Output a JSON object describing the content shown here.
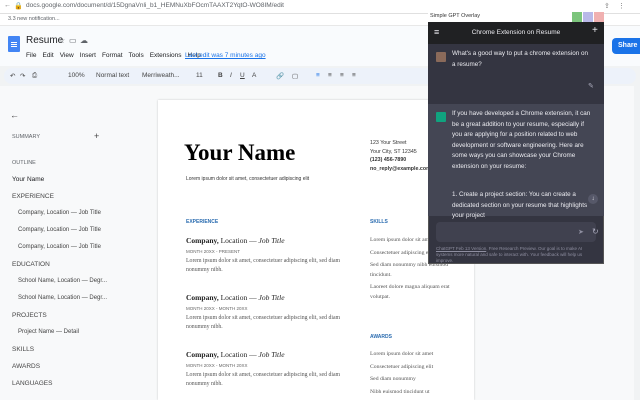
{
  "browser": {
    "url": "docs.google.com/document/d/15DgnaVnli_b1_HEMNuXbFOcmTAAXT2YqtO-WO8IM/edit",
    "bookmark": "3.3 new notification..."
  },
  "doc": {
    "title": "Resume",
    "menus": [
      "File",
      "Edit",
      "View",
      "Insert",
      "Format",
      "Tools",
      "Extensions",
      "Help"
    ],
    "last_edit": "Last edit was 7 minutes ago",
    "share_label": "Share"
  },
  "toolbar": {
    "zoom": "100%",
    "style": "Normal text",
    "font": "Merriweath...",
    "size": "11"
  },
  "outline": {
    "summary_label": "SUMMARY",
    "outline_label": "OUTLINE",
    "items": [
      {
        "label": "Your Name",
        "level": 1
      },
      {
        "label": "EXPERIENCE",
        "level": 1
      },
      {
        "label": "Company, Location — Job Title",
        "level": 2
      },
      {
        "label": "Company, Location — Job Title",
        "level": 2
      },
      {
        "label": "Company, Location — Job Title",
        "level": 2
      },
      {
        "label": "EDUCATION",
        "level": 1
      },
      {
        "label": "School Name, Location — Degr...",
        "level": 2
      },
      {
        "label": "School Name, Location — Degr...",
        "level": 2
      },
      {
        "label": "PROJECTS",
        "level": 1
      },
      {
        "label": "Project Name — Detail",
        "level": 2
      },
      {
        "label": "SKILLS",
        "level": 1
      },
      {
        "label": "AWARDS",
        "level": 1
      },
      {
        "label": "LANGUAGES",
        "level": 1
      }
    ]
  },
  "resume": {
    "name": "Your Name",
    "tagline": "Lorem ipsum dolor sit amet, consectetuer adipiscing elit",
    "address1": "123 Your Street",
    "address2": "Your City, ST 12345",
    "phone": "(123) 456-7890",
    "email": "no_reply@example.com",
    "experience_heading": "EXPERIENCE",
    "skills_heading": "SKILLS",
    "awards_heading": "AWARDS",
    "jobs": [
      {
        "company": "Company,",
        "rest": " Location — ",
        "title": "Job Title",
        "dates": "MONTH 20XX - PRESENT",
        "desc": "Lorem ipsum dolor sit amet, consectetuer adipiscing elit, sed diam nonummy nibh."
      },
      {
        "company": "Company,",
        "rest": " Location — ",
        "title": "Job Title",
        "dates": "MONTH 20XX - MONTH 20XX",
        "desc": "Lorem ipsum dolor sit amet, consectetuer adipiscing elit, sed diam nonummy nibh."
      },
      {
        "company": "Company,",
        "rest": " Location — ",
        "title": "Job Title",
        "dates": "MONTH 20XX - MONTH 20XX",
        "desc": "Lorem ipsum dolor sit amet, consectetuer adipiscing elit, sed diam nonummy nibh."
      }
    ],
    "skills_lines": [
      "Lorem ipsum dolor sit amet.",
      "Consectetuer adipiscing elit.",
      "Sed diam nonummy nibh euismod tincidunt.",
      "Laoreet dolore magna aliquam erat volutpat."
    ],
    "awards_lines": [
      "Lorem ipsum dolor sit amet",
      "Consectetuer adipiscing elit",
      "Sed diam nonummy",
      "Nibh euismod tincidunt ut"
    ]
  },
  "chat": {
    "overlay_label": "Simple GPT Overlay",
    "title": "Chrome Extension on Resume",
    "user_msg": "What's a good way to put a chrome extension on a resume?",
    "assistant_msg": "If you have developed a Chrome extension, it can be a great addition to your resume, especially if you are applying for a position related to web development or software engineering. Here are some ways you can showcase your Chrome extension on your resume:",
    "list_item": "1.   Create a project section: You can create a dedicated section on your resume that highlights your project",
    "footer_link": "ChatGPT Feb 13 Version",
    "footer_text": ". Free Research Preview. Our goal is to make AI systems more natural and safe to interact with. Your feedback will help us improve."
  },
  "colors": {
    "accent": "#1a73e8",
    "chat_bg": "#343541",
    "chat_assistant_bg": "#444654",
    "gpt_green": "#10a37f"
  }
}
